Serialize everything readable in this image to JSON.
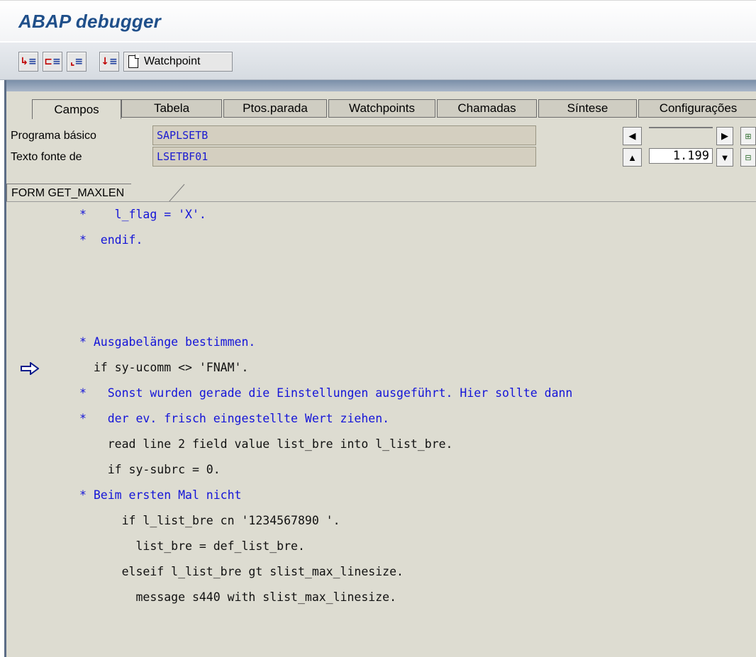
{
  "window": {
    "title": "ABAP debugger"
  },
  "toolbar": {
    "buttons": [
      {
        "icon": "single-step-icon"
      },
      {
        "icon": "execute-icon"
      },
      {
        "icon": "return-icon"
      },
      {
        "icon": "continue-icon"
      }
    ],
    "watchpoint_label": "Watchpoint"
  },
  "tabs": [
    "Campos",
    "Tabela",
    "Ptos.parada",
    "Watchpoints",
    "Chamadas",
    "Síntese",
    "Configurações"
  ],
  "active_tab": "Campos",
  "fields": {
    "program_label": "Programa básico",
    "program_value": "SAPLSETB",
    "source_label": "Texto fonte de",
    "source_value": "LSETBF01",
    "line_top": "",
    "line_number": "1.199"
  },
  "editor": {
    "form_tab": "FORM GET_MAXLEN",
    "current_line_marker": "arrow-right",
    "lines": [
      {
        "text": "*    l_flag = 'X'.",
        "kind": "comment"
      },
      {
        "text": "*  endif.",
        "kind": "comment"
      },
      {
        "text": "",
        "kind": "normal"
      },
      {
        "text": "",
        "kind": "normal"
      },
      {
        "text": "",
        "kind": "normal"
      },
      {
        "text": "* Ausgabelänge bestimmen.",
        "kind": "comment"
      },
      {
        "text": "  if sy-ucomm <> 'FNAM'.",
        "kind": "normal",
        "current": true
      },
      {
        "text": "*   Sonst wurden gerade die Einstellungen ausgeführt. Hier sollte dann",
        "kind": "comment"
      },
      {
        "text": "*   der ev. frisch eingestellte Wert ziehen.",
        "kind": "comment"
      },
      {
        "text": "    read line 2 field value list_bre into l_list_bre.",
        "kind": "normal"
      },
      {
        "text": "    if sy-subrc = 0.",
        "kind": "normal"
      },
      {
        "text": "* Beim ersten Mal nicht",
        "kind": "comment"
      },
      {
        "text": "      if l_list_bre cn '1234567890 '.",
        "kind": "normal"
      },
      {
        "text": "        list_bre = def_list_bre.",
        "kind": "normal"
      },
      {
        "text": "      elseif l_list_bre gt slist_max_linesize.",
        "kind": "normal"
      },
      {
        "text": "        message s440 with slist_max_linesize.",
        "kind": "normal"
      }
    ]
  }
}
